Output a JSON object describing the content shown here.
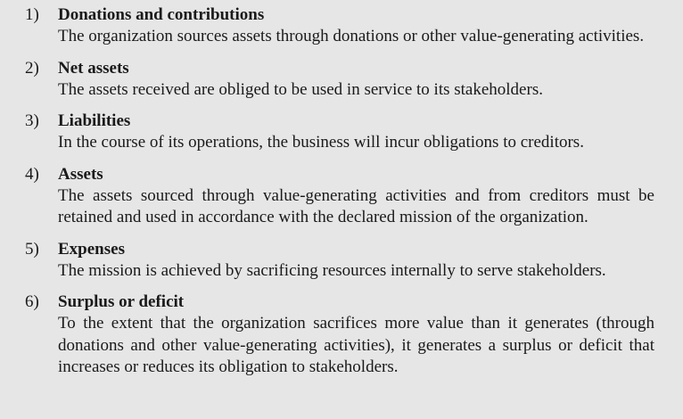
{
  "items": [
    {
      "number": "1)",
      "title": "Donations and contributions",
      "description": "The organization sources assets through donations or other value-generating activities."
    },
    {
      "number": "2)",
      "title": "Net assets",
      "description": "The assets received are obliged to be used in service to its stakeholders."
    },
    {
      "number": "3)",
      "title": "Liabilities",
      "description": "In the course of its operations, the business will incur obligations to creditors."
    },
    {
      "number": "4)",
      "title": "Assets",
      "description": "The assets sourced through value-generating activities and from creditors must be retained and used in accordance with the declared mission of the organization."
    },
    {
      "number": "5)",
      "title": "Expenses",
      "description": "The mission is achieved by sacrificing resources internally to serve stakeholders."
    },
    {
      "number": "6)",
      "title": "Surplus or deficit",
      "description": "To the extent that the organization sacrifices more value than it generates (through donations and other value-generating activities), it generates a surplus or deficit that increases or reduces its obligation to stakeholders."
    }
  ]
}
